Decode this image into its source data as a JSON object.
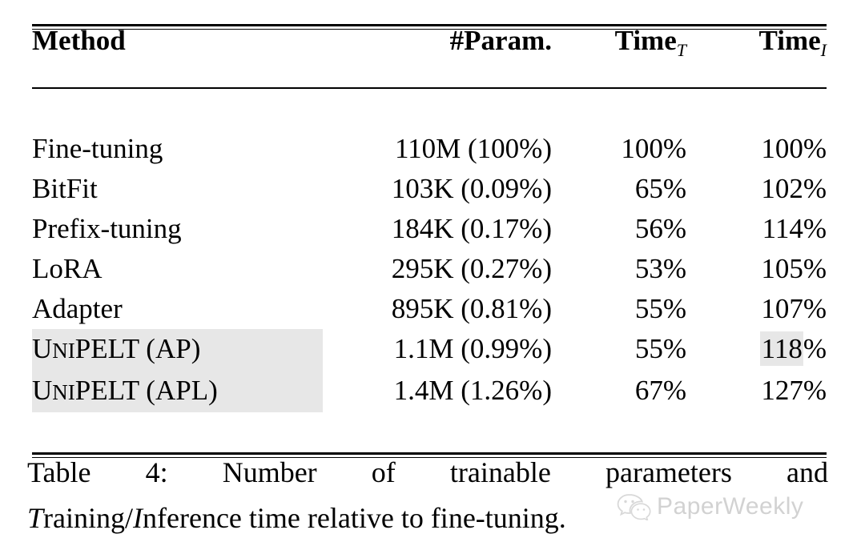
{
  "table": {
    "columns": [
      {
        "key": "method",
        "label": "Method"
      },
      {
        "key": "param",
        "label": "#Param."
      },
      {
        "key": "time_t",
        "label": "Time",
        "subscript": "T"
      },
      {
        "key": "time_i",
        "label": "Time",
        "subscript": "I"
      }
    ],
    "rows": [
      {
        "method": "Fine-tuning",
        "param": "110M (100%)",
        "time_t": "100%",
        "time_i": "100%",
        "highlight_row": false,
        "highlight_time_i": false
      },
      {
        "method": "BitFit",
        "param": "103K (0.09%)",
        "time_t": "65%",
        "time_i": "102%",
        "highlight_row": false,
        "highlight_time_i": false
      },
      {
        "method": "Prefix-tuning",
        "param": "184K (0.17%)",
        "time_t": "56%",
        "time_i": "114%",
        "highlight_row": false,
        "highlight_time_i": false
      },
      {
        "method": "LoRA",
        "param": "295K (0.27%)",
        "time_t": "53%",
        "time_i": "105%",
        "highlight_row": false,
        "highlight_time_i": false
      },
      {
        "method": "Adapter",
        "param": "895K (0.81%)",
        "time_t": "55%",
        "time_i": "107%",
        "highlight_row": false,
        "highlight_time_i": false
      },
      {
        "method": "UNIPELT (AP)",
        "method_parts": {
          "u": "U",
          "ni": "NI",
          "pelt": "PELT",
          "variant": " (AP)"
        },
        "param": "1.1M (0.99%)",
        "time_t": "55%",
        "time_i_number": "118",
        "time_i_percent": "%",
        "time_i": "118%",
        "highlight_row": true,
        "highlight_time_i": true
      },
      {
        "method": "UNIPELT (APL)",
        "method_parts": {
          "u": "U",
          "ni": "NI",
          "pelt": "PELT",
          "variant": " (APL)"
        },
        "param": "1.4M (1.26%)",
        "time_t": "67%",
        "time_i_number": "127",
        "time_i_percent": "%",
        "time_i": "127%",
        "highlight_row": true,
        "highlight_time_i": false
      }
    ],
    "highlight_color": "#e7e7e7"
  },
  "caption": {
    "line1": "Table 4:   Number of trainable parameters and",
    "label": "Table 4:",
    "line2_pre": "",
    "line2_t": "T",
    "line2_mid": "raining/",
    "line2_i": "I",
    "line2_post": "nference time relative to fine-tuning.",
    "full": "Table 4: Number of trainable parameters and Training/Inference time relative to fine-tuning."
  },
  "watermark": {
    "text": "PaperWeekly",
    "logo": "wechat-icon",
    "color": "#d2d2d2"
  }
}
